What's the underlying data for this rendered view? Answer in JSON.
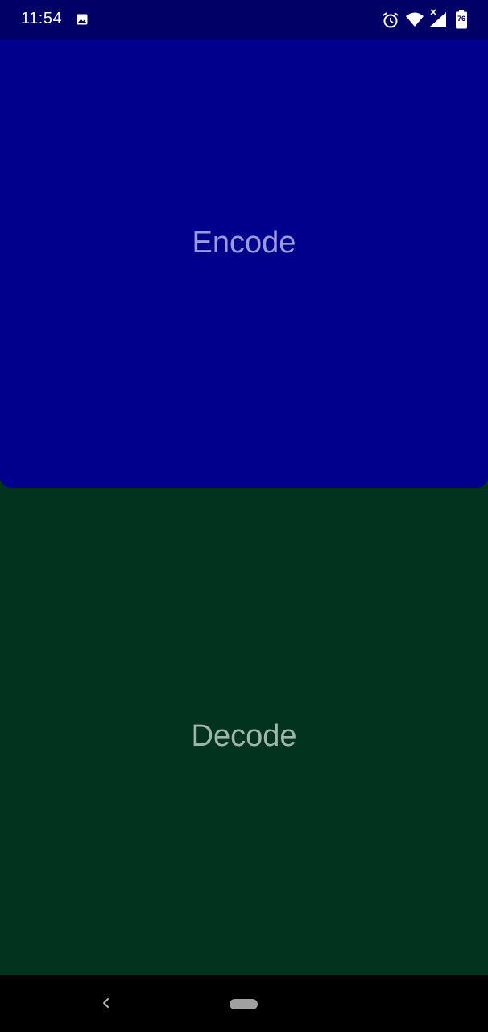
{
  "status_bar": {
    "time": "11:54",
    "icons": [
      "image-icon",
      "alarm-icon",
      "wifi-icon",
      "cell-signal-icon",
      "battery-icon"
    ],
    "battery_level": "76",
    "background": "#000066"
  },
  "main": {
    "encode_label": "Encode",
    "decode_label": "Decode",
    "encode_color": "#00008c",
    "decode_color": "#01331f"
  },
  "nav_bar": {
    "icons": [
      "back-icon",
      "home-pill"
    ]
  }
}
